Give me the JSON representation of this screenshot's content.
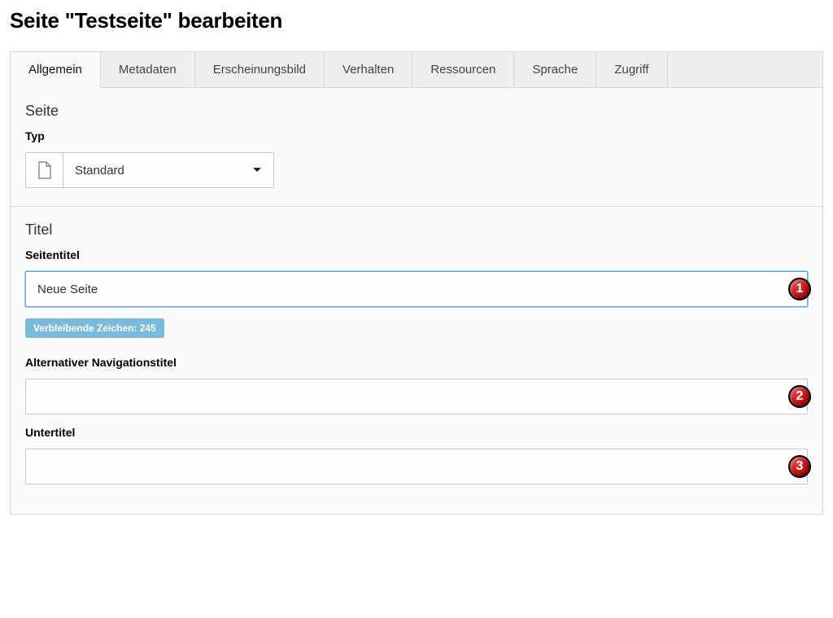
{
  "page_title": "Seite \"Testseite\" bearbeiten",
  "tabs": [
    {
      "label": "Allgemein",
      "active": true
    },
    {
      "label": "Metadaten",
      "active": false
    },
    {
      "label": "Erscheinungsbild",
      "active": false
    },
    {
      "label": "Verhalten",
      "active": false
    },
    {
      "label": "Ressourcen",
      "active": false
    },
    {
      "label": "Sprache",
      "active": false
    },
    {
      "label": "Zugriff",
      "active": false
    }
  ],
  "section_seite": {
    "title": "Seite",
    "type_label": "Typ",
    "type_value": "Standard"
  },
  "section_titel": {
    "title": "Titel",
    "seitentitel_label": "Seitentitel",
    "seitentitel_value": "Neue Seite",
    "remaining_text": "Verbleibende Zeichen: 245",
    "nav_label": "Alternativer Navigationstitel",
    "nav_value": "",
    "untertitel_label": "Untertitel",
    "untertitel_value": ""
  },
  "markers": {
    "m1": "1",
    "m2": "2",
    "m3": "3"
  }
}
